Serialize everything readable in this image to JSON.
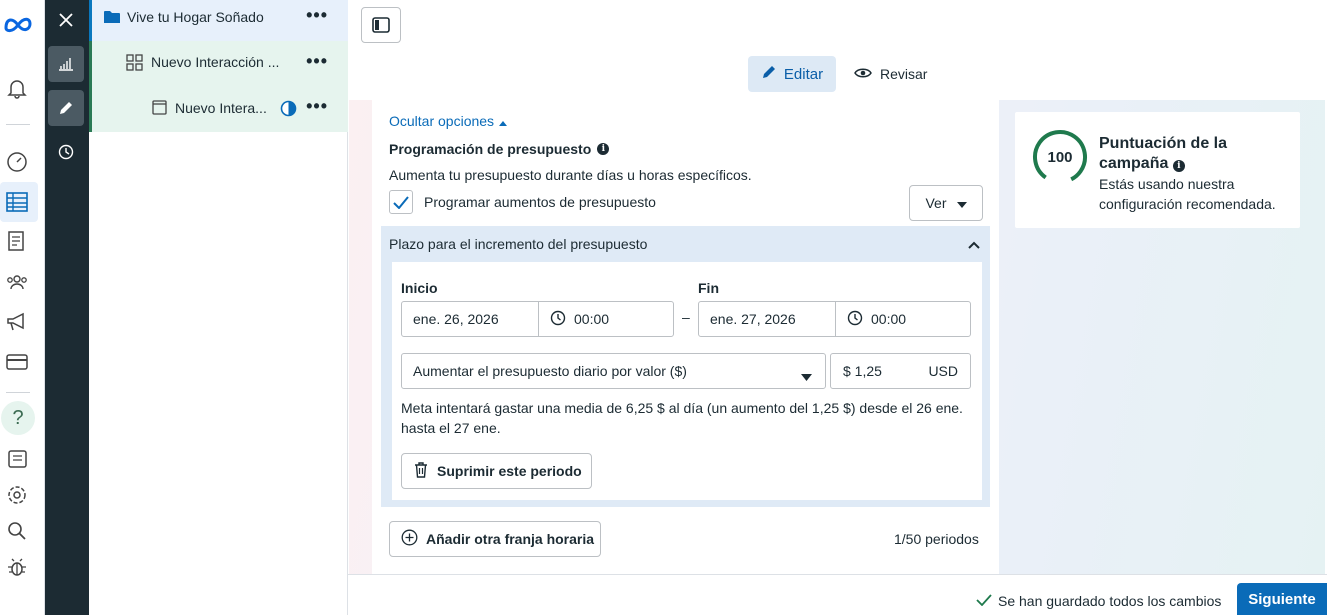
{
  "tree": {
    "campaign": "Vive tu Hogar Soñado",
    "adset": "Nuevo Interacción ...",
    "ad": "Nuevo Intera..."
  },
  "header": {
    "edit_label": "Editar",
    "review_label": "Revisar"
  },
  "budget": {
    "hide_options": "Ocultar opciones",
    "schedule_title": "Programación de presupuesto",
    "schedule_desc": "Aumenta tu presupuesto durante días u horas específicos.",
    "schedule_checkbox": "Programar aumentos de presupuesto",
    "view_button": "Ver",
    "period_header": "Plazo para el incremento del presupuesto",
    "start_label": "Inicio",
    "end_label": "Fin",
    "start_date": "ene. 26, 2026",
    "start_time": "00:00",
    "end_date": "ene. 27, 2026",
    "end_time": "00:00",
    "dash": "–",
    "increase_type": "Aumentar el presupuesto diario por valor ($)",
    "amount": "$ 1,25",
    "currency": "USD",
    "info": "Meta intentará gastar una media de 6,25 $ al día (un aumento del 1,25 $) desde el 26 ene. hasta el 27 ene.",
    "delete_period": "Suprimir este periodo",
    "add_slot": "Añadir otra franja horaria",
    "period_count": "1/50 periodos"
  },
  "score": {
    "value": "100",
    "title": "Puntuación de la campaña",
    "subtitle": "Estás usando nuestra configuración recomendada."
  },
  "footer": {
    "saved": "Se han guardado todos los cambios",
    "next": "Siguiente"
  },
  "colors": {
    "accent": "#0a6bb8",
    "dark_toolbar": "#1c2b33",
    "score_ring": "#1f7a4d"
  }
}
